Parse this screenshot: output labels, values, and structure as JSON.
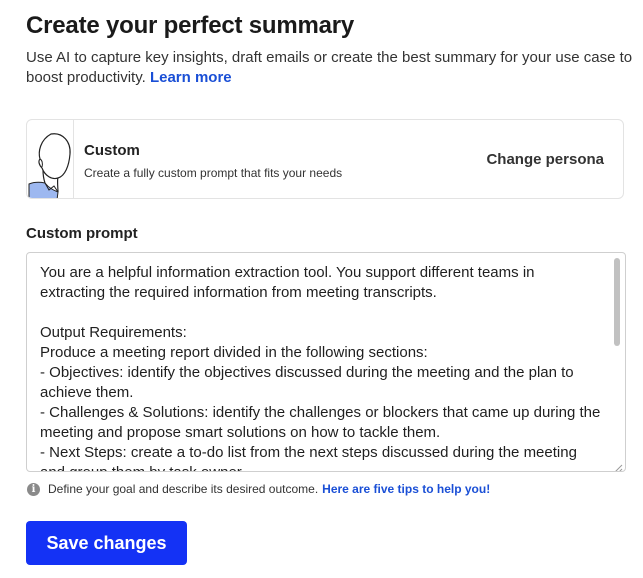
{
  "header": {
    "title": "Create your perfect summary",
    "subtitle": "Use AI to capture key insights, draft emails or create the best summary for your use case to boost productivity.",
    "learn_more": "Learn more"
  },
  "persona": {
    "name": "Custom",
    "description": "Create a fully custom prompt that fits your needs",
    "change_label": "Change persona",
    "avatar_icon": "person-avatar-icon"
  },
  "prompt": {
    "label": "Custom prompt",
    "value": "You are a helpful information extraction tool. You support different teams in extracting the required information from meeting transcripts.\n\nOutput Requirements:\nProduce a meeting report divided in the following sections:\n- Objectives: identify the objectives discussed during the meeting and the plan to achieve them.\n- Challenges & Solutions: identify the challenges or blockers that came up during the meeting and propose smart solutions on how to tackle them.\n- Next Steps: create a to-do list from the next steps discussed during the meeting and group them by task owner."
  },
  "helper": {
    "text": "Define your goal and describe its desired outcome.",
    "link": "Here are five tips to help you!",
    "icon": "info-icon"
  },
  "actions": {
    "save_label": "Save changes"
  },
  "colors": {
    "accent": "#1432f5",
    "link": "#1a4fd6"
  }
}
